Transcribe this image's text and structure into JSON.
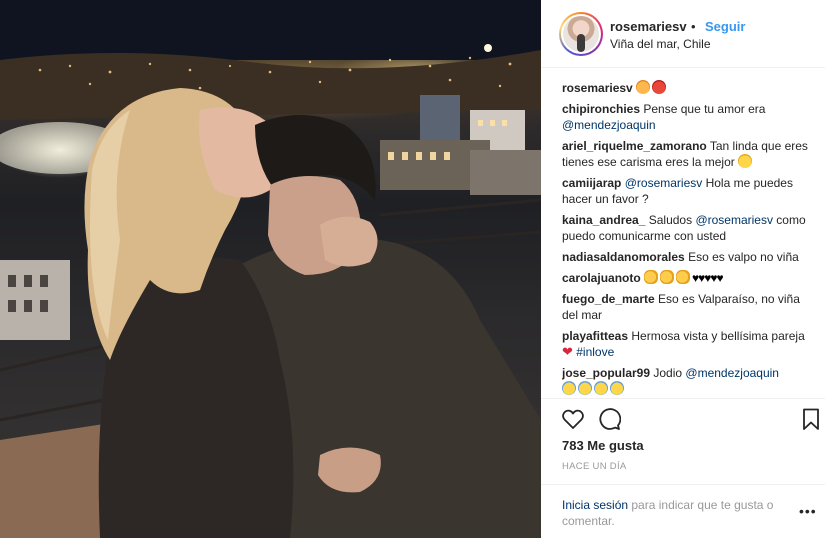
{
  "post": {
    "username": "rosemariesv",
    "follow_label": "Seguir",
    "separator": "•",
    "location": "Viña del mar, Chile"
  },
  "comments": [
    {
      "user": "rosemariesv",
      "text": "",
      "emojis": [
        "tiger-face",
        "devil-face"
      ]
    },
    {
      "user": "chipironchies",
      "text": "Pense que tu amor era ",
      "mention": "@mendezjoaquin"
    },
    {
      "user": "ariel_riquelme_zamorano",
      "text": "Tan linda que eres tienes ese carisma eres la mejor ",
      "emojis": [
        "smiling-face"
      ]
    },
    {
      "user": "camiijarap",
      "mention": "@rosemariesv",
      "text": " Hola me puedes hacer un favor ?"
    },
    {
      "user": "kaina_andrea_",
      "text": "Saludos ",
      "mention": "@rosemariesv",
      "text2": " como puedo comunicarme con usted"
    },
    {
      "user": "nadiasaldanomorales",
      "text": "Eso es valpo no viña"
    },
    {
      "user": "carolajuanoto",
      "emojis": [
        "clap",
        "clap",
        "clap"
      ],
      "text": "♥♥♥♥♥"
    },
    {
      "user": "fuego_de_marte",
      "text": "Eso es Valparaíso, no viña del mar"
    },
    {
      "user": "playafitteas",
      "text": "Hermosa vista y bellísima pareja ",
      "heart": "❤",
      "hashtag": "#inlove"
    },
    {
      "user": "jose_popular99",
      "text": "Jodio ",
      "mention": "@mendezjoaquin",
      "emojis": [
        "crying-laughing",
        "crying-laughing",
        "crying-laughing",
        "crying-laughing"
      ]
    }
  ],
  "likes": "783 Me gusta",
  "timestamp": "HACE UN DÍA",
  "footer": {
    "login_link": "Inicia sesión",
    "login_text": " para indicar que te gusta o comentar.",
    "more": "•••"
  },
  "icons": {
    "like": "heart-outline-icon",
    "comment": "comment-bubble-icon",
    "save": "bookmark-icon",
    "more": "more-options-icon"
  }
}
